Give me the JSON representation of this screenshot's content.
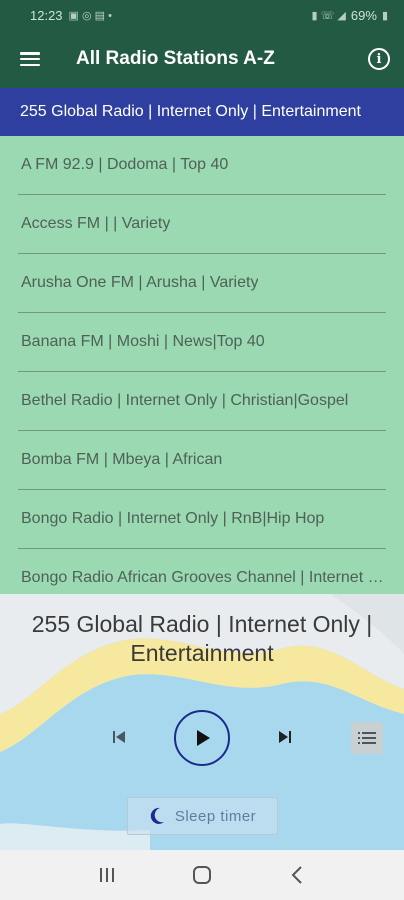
{
  "status_bar": {
    "time": "12:23",
    "battery": "69%"
  },
  "app_bar": {
    "title": "All Radio Stations A-Z",
    "menu_icon": "hamburger-menu-icon",
    "info_icon": "info-icon"
  },
  "now_playing_banner": "255 Global Radio | Internet Only | Entertainment",
  "stations": [
    "A FM 92.9 | Dodoma | Top 40",
    "Access FM | | Variety",
    "Arusha One FM | Arusha | Variety",
    "Banana FM | Moshi | News|Top 40",
    "Bethel Radio | Internet Only | Christian|Gospel",
    "Bomba FM | Mbeya | African",
    "Bongo Radio | Internet Only | RnB|Hip Hop",
    "Bongo Radio African Grooves Channel | Internet Only | African"
  ],
  "player": {
    "title": "255 Global Radio | Internet Only | Entertainment",
    "sleep_timer_label": "Sleep timer"
  },
  "colors": {
    "app_bar": "#235a44",
    "banner": "#2f3fa0",
    "list_bg": "#9ad9b2",
    "play_ring": "#1d2a8a"
  }
}
